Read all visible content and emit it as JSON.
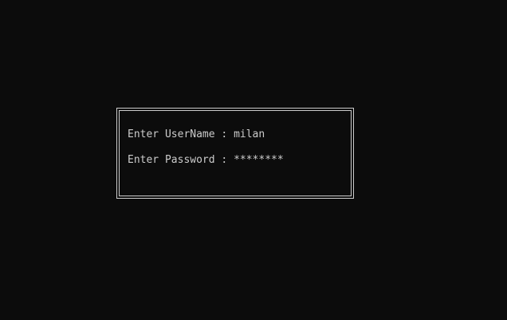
{
  "login": {
    "username_prompt": "Enter UserName : ",
    "username_value": "milan",
    "password_prompt": "Enter Password : ",
    "password_value": "********"
  },
  "colors": {
    "background": "#0c0c0c",
    "foreground": "#cccccc"
  }
}
